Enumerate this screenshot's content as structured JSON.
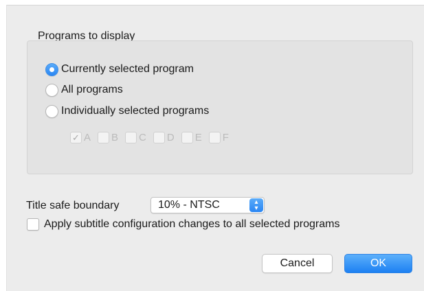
{
  "programs_group": {
    "title": "Programs to display",
    "options": [
      {
        "label": "Currently selected program",
        "checked": true
      },
      {
        "label": "All programs",
        "checked": false
      },
      {
        "label": "Individually selected programs",
        "checked": false
      }
    ],
    "program_checkboxes": [
      {
        "label": "A",
        "checked": true
      },
      {
        "label": "B",
        "checked": false
      },
      {
        "label": "C",
        "checked": false
      },
      {
        "label": "D",
        "checked": false
      },
      {
        "label": "E",
        "checked": false
      },
      {
        "label": "F",
        "checked": false
      }
    ]
  },
  "title_safe": {
    "label": "Title safe boundary",
    "value": "10% - NTSC"
  },
  "apply_subtitle": {
    "label": "Apply subtitle configuration changes to all selected programs",
    "checked": false
  },
  "buttons": {
    "cancel": "Cancel",
    "ok": "OK"
  },
  "colors": {
    "accent": "#2a86f3",
    "dialog_bg": "#ececec",
    "group_bg": "#e3e3e3"
  },
  "icons": {
    "checkmark": "check-icon",
    "popup": "up-down-chevron-icon"
  }
}
